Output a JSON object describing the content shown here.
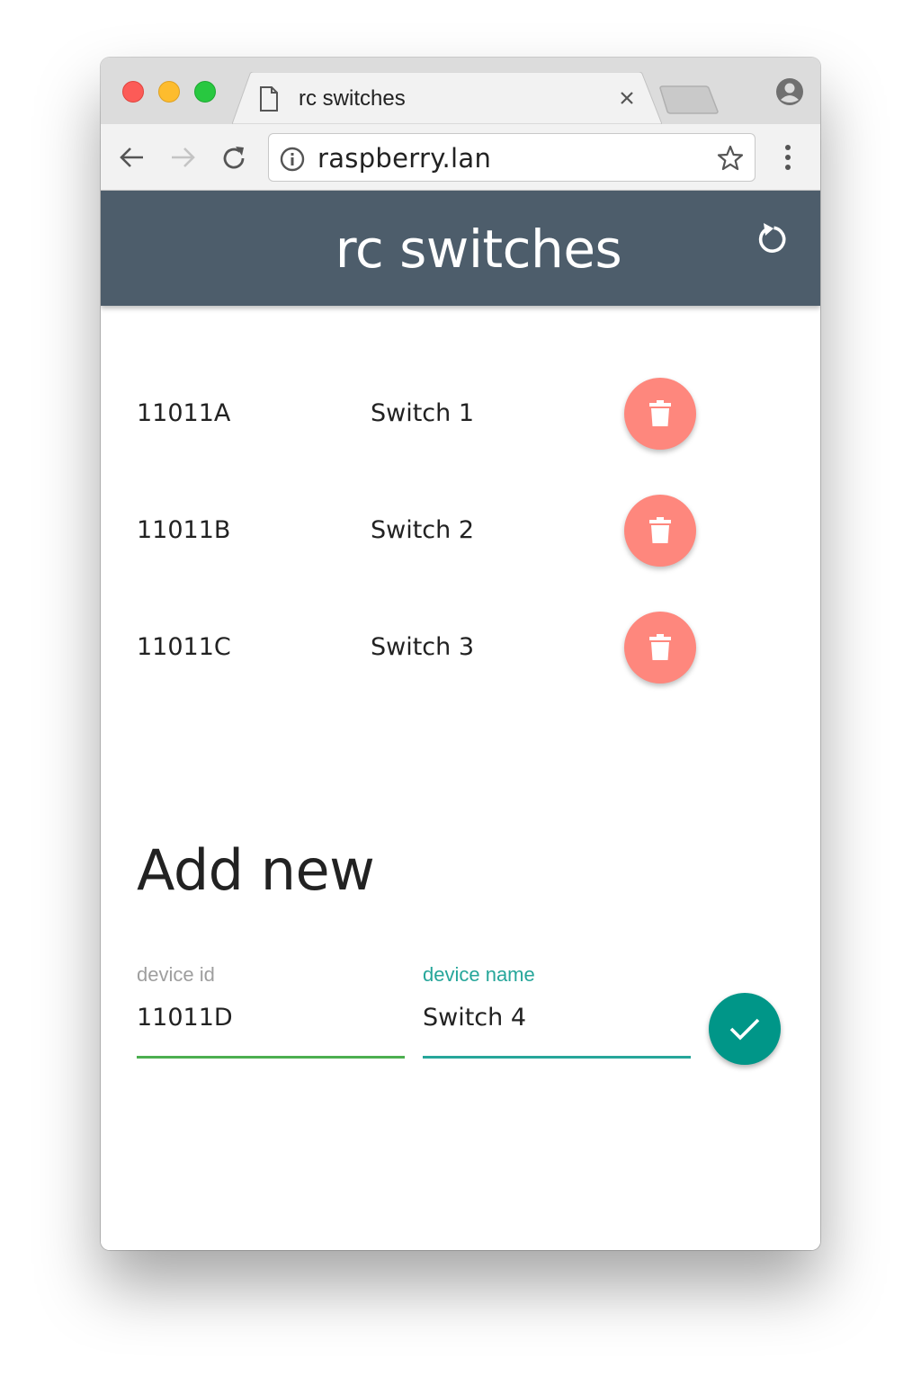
{
  "browser": {
    "tab_title": "rc switches",
    "url": "raspberry.lan"
  },
  "app": {
    "title": "rc switches"
  },
  "switches": [
    {
      "id": "11011A",
      "name": "Switch 1"
    },
    {
      "id": "11011B",
      "name": "Switch 2"
    },
    {
      "id": "11011C",
      "name": "Switch 3"
    }
  ],
  "add_new": {
    "title": "Add new",
    "device_id_label": "device id",
    "device_id_value": "11011D",
    "device_name_label": "device name",
    "device_name_value": "Switch 4"
  },
  "colors": {
    "header_bg": "#4d5d6b",
    "delete_button": "#fe877d",
    "submit_button": "#009688",
    "device_id_underline": "#4caf50",
    "device_name_underline": "#26a69a",
    "device_name_label": "#26a69a",
    "device_id_label": "#9e9e9e"
  },
  "icons": {
    "delete": "trash-icon",
    "submit": "check-icon",
    "refresh": "refresh-icon"
  }
}
